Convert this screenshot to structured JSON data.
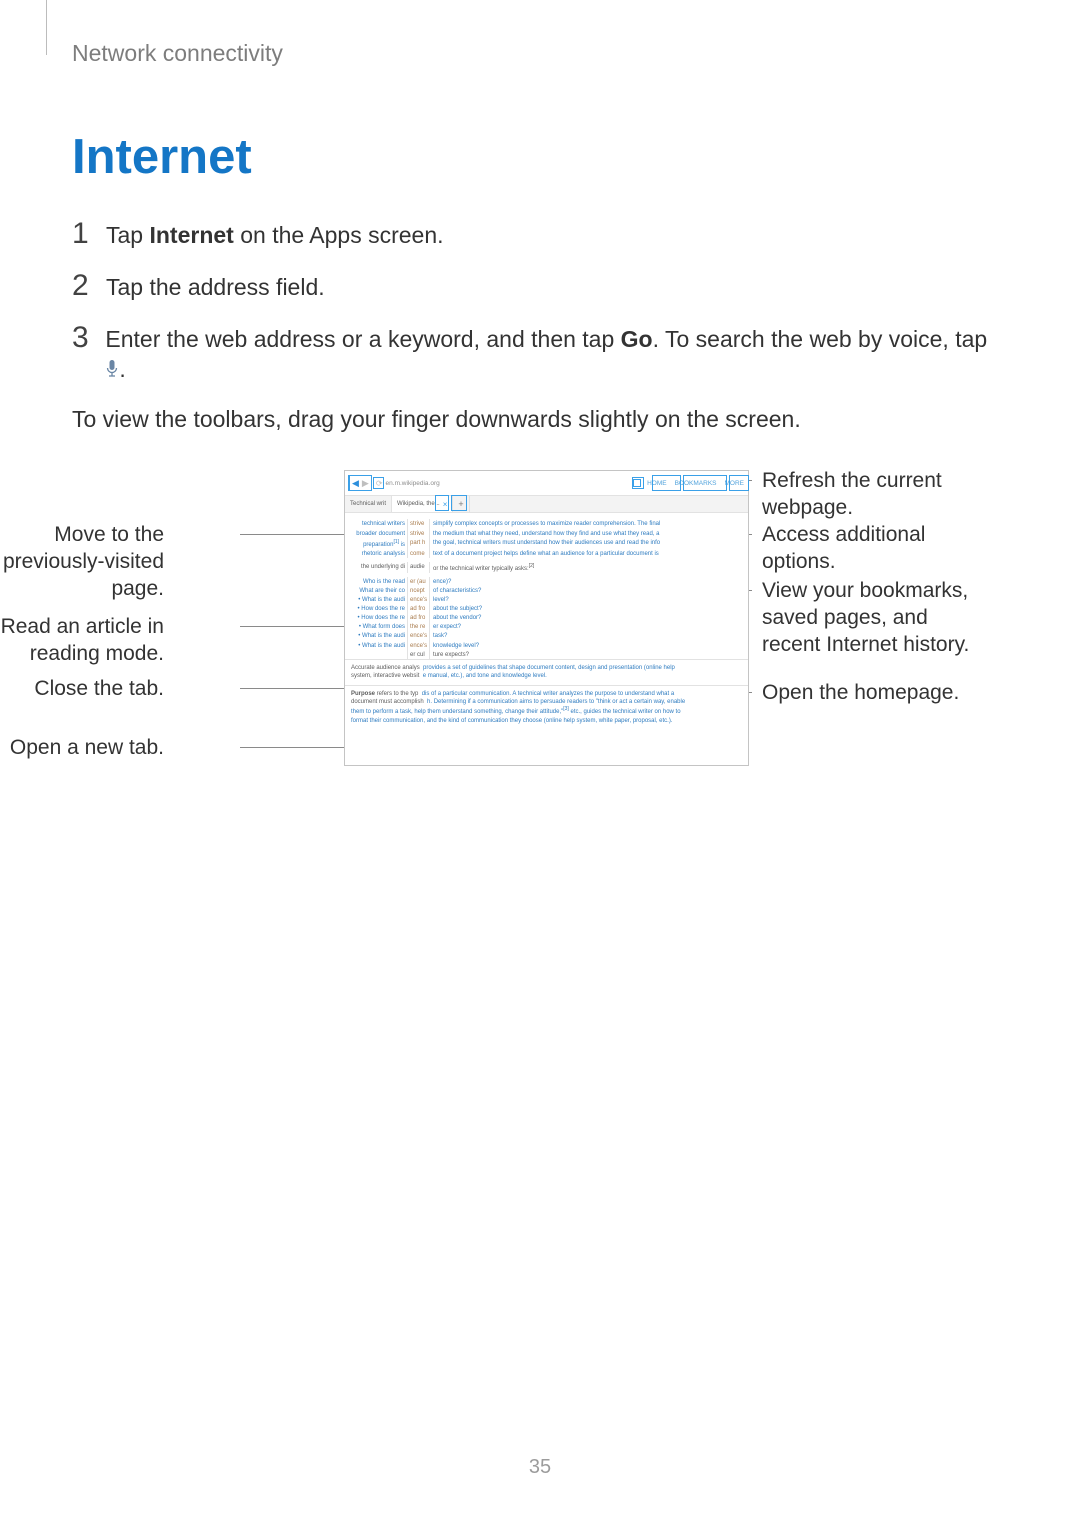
{
  "header": {
    "section_label": "Network connectivity"
  },
  "title": "Internet",
  "steps": [
    {
      "num": "1",
      "before": "Tap ",
      "bold": "Internet",
      "after": " on the Apps screen."
    },
    {
      "num": "2",
      "before": "Tap the address field.",
      "bold": "",
      "after": ""
    },
    {
      "num": "3",
      "before": "Enter the web address or a keyword, and then tap ",
      "bold": "Go",
      "after": ". To search the web by voice, tap "
    }
  ],
  "step3_tail": ".",
  "body_line": "To view the toolbars, drag your finger downwards slightly on the screen.",
  "callouts": {
    "left_1": "Move to the previously-visited page.",
    "left_2": "Read an article in reading mode.",
    "left_3": "Close the tab.",
    "left_4": "Open a new tab.",
    "right_1": "Refresh the current webpage.",
    "right_2": "Access additional options.",
    "right_3": "View your bookmarks, saved pages, and recent Internet history.",
    "right_4": "Open the homepage."
  },
  "browser": {
    "url": "en.m.wikipedia.org",
    "tab_left_label": "Technical writ",
    "tab_active_label": "Wikipedia, the...",
    "toolbar_items": [
      "HOME",
      "BOOKMARKS",
      "MORE"
    ]
  },
  "page_number": "35"
}
